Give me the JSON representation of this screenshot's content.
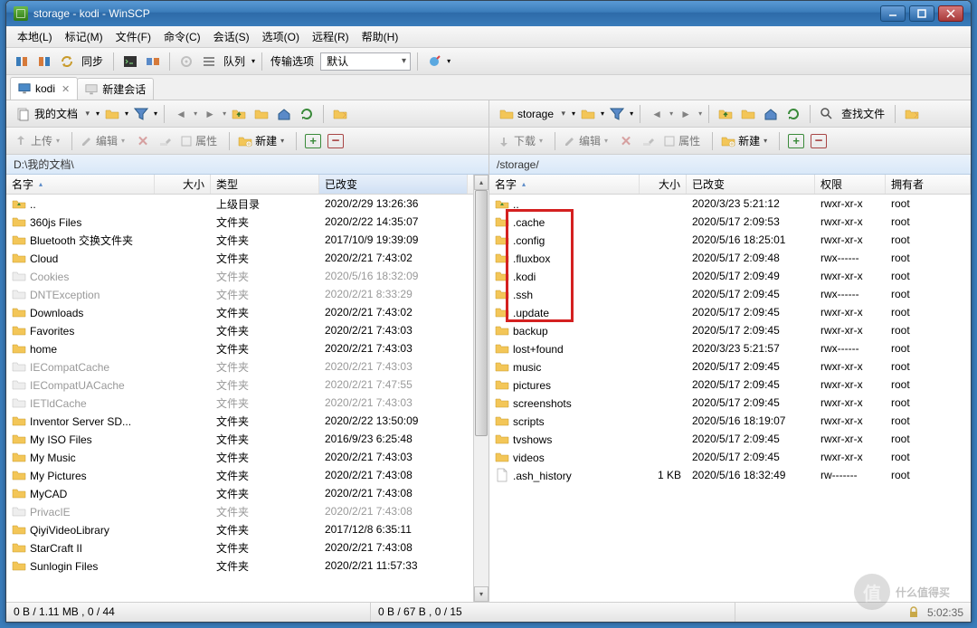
{
  "title": "storage - kodi - WinSCP",
  "menus": [
    "本地(L)",
    "标记(M)",
    "文件(F)",
    "命令(C)",
    "会话(S)",
    "选项(O)",
    "远程(R)",
    "帮助(H)"
  ],
  "toolbar": {
    "sync": "同步",
    "queue": "队列",
    "transfer_label": "传输选项",
    "transfer_value": "默认"
  },
  "tabs": {
    "kodi": "kodi",
    "new": "新建会话"
  },
  "navL": {
    "dir": "我的文档"
  },
  "navR": {
    "dir": "storage",
    "find": "查找文件"
  },
  "actions": {
    "upload": "上传",
    "download": "下载",
    "edit": "编辑",
    "props": "属性",
    "new": "新建"
  },
  "pathL": "D:\\我的文档\\",
  "pathR": "/storage/",
  "hdrL": {
    "name": "名字",
    "size": "大小",
    "type": "类型",
    "changed": "已改变"
  },
  "hdrR": {
    "name": "名字",
    "size": "大小",
    "changed": "已改变",
    "rights": "权限",
    "owner": "拥有者"
  },
  "leftRows": [
    {
      "n": "..",
      "t": "上级目录",
      "c": "2020/2/29  13:26:36",
      "up": true
    },
    {
      "n": "360js Files",
      "t": "文件夹",
      "c": "2020/2/22  14:35:07"
    },
    {
      "n": "Bluetooth 交换文件夹",
      "t": "文件夹",
      "c": "2017/10/9  19:39:09"
    },
    {
      "n": "Cloud",
      "t": "文件夹",
      "c": "2020/2/21  7:43:02"
    },
    {
      "n": "Cookies",
      "t": "文件夹",
      "c": "2020/5/16  18:32:09",
      "dim": true
    },
    {
      "n": "DNTException",
      "t": "文件夹",
      "c": "2020/2/21  8:33:29",
      "dim": true
    },
    {
      "n": "Downloads",
      "t": "文件夹",
      "c": "2020/2/21  7:43:02"
    },
    {
      "n": "Favorites",
      "t": "文件夹",
      "c": "2020/2/21  7:43:03"
    },
    {
      "n": "home",
      "t": "文件夹",
      "c": "2020/2/21  7:43:03"
    },
    {
      "n": "IECompatCache",
      "t": "文件夹",
      "c": "2020/2/21  7:43:03",
      "dim": true
    },
    {
      "n": "IECompatUACache",
      "t": "文件夹",
      "c": "2020/2/21  7:47:55",
      "dim": true
    },
    {
      "n": "IETldCache",
      "t": "文件夹",
      "c": "2020/2/21  7:43:03",
      "dim": true
    },
    {
      "n": "Inventor Server SD...",
      "t": "文件夹",
      "c": "2020/2/22  13:50:09"
    },
    {
      "n": "My ISO Files",
      "t": "文件夹",
      "c": "2016/9/23  6:25:48"
    },
    {
      "n": "My Music",
      "t": "文件夹",
      "c": "2020/2/21  7:43:03"
    },
    {
      "n": "My Pictures",
      "t": "文件夹",
      "c": "2020/2/21  7:43:08"
    },
    {
      "n": "MyCAD",
      "t": "文件夹",
      "c": "2020/2/21  7:43:08"
    },
    {
      "n": "PrivacIE",
      "t": "文件夹",
      "c": "2020/2/21  7:43:08",
      "dim": true
    },
    {
      "n": "QiyiVideoLibrary",
      "t": "文件夹",
      "c": "2017/12/8  6:35:11"
    },
    {
      "n": "StarCraft II",
      "t": "文件夹",
      "c": "2020/2/21  7:43:08"
    },
    {
      "n": "Sunlogin Files",
      "t": "文件夹",
      "c": "2020/2/21  11:57:33"
    }
  ],
  "rightRows": [
    {
      "n": "..",
      "c": "2020/3/23  5:21:12",
      "r": "rwxr-xr-x",
      "o": "root",
      "up": true
    },
    {
      "n": ".cache",
      "c": "2020/5/17  2:09:53",
      "r": "rwxr-xr-x",
      "o": "root"
    },
    {
      "n": ".config",
      "c": "2020/5/16  18:25:01",
      "r": "rwxr-xr-x",
      "o": "root"
    },
    {
      "n": ".fluxbox",
      "c": "2020/5/17  2:09:48",
      "r": "rwx------",
      "o": "root"
    },
    {
      "n": ".kodi",
      "c": "2020/5/17  2:09:49",
      "r": "rwxr-xr-x",
      "o": "root"
    },
    {
      "n": ".ssh",
      "c": "2020/5/17  2:09:45",
      "r": "rwx------",
      "o": "root"
    },
    {
      "n": ".update",
      "c": "2020/5/17  2:09:45",
      "r": "rwxr-xr-x",
      "o": "root"
    },
    {
      "n": "backup",
      "c": "2020/5/17  2:09:45",
      "r": "rwxr-xr-x",
      "o": "root"
    },
    {
      "n": "lost+found",
      "c": "2020/3/23  5:21:57",
      "r": "rwx------",
      "o": "root"
    },
    {
      "n": "music",
      "c": "2020/5/17  2:09:45",
      "r": "rwxr-xr-x",
      "o": "root"
    },
    {
      "n": "pictures",
      "c": "2020/5/17  2:09:45",
      "r": "rwxr-xr-x",
      "o": "root"
    },
    {
      "n": "screenshots",
      "c": "2020/5/17  2:09:45",
      "r": "rwxr-xr-x",
      "o": "root"
    },
    {
      "n": "scripts",
      "c": "2020/5/16  18:19:07",
      "r": "rwxr-xr-x",
      "o": "root"
    },
    {
      "n": "tvshows",
      "c": "2020/5/17  2:09:45",
      "r": "rwxr-xr-x",
      "o": "root"
    },
    {
      "n": "videos",
      "c": "2020/5/17  2:09:45",
      "r": "rwxr-xr-x",
      "o": "root"
    },
    {
      "n": ".ash_history",
      "s": "1 KB",
      "c": "2020/5/16  18:32:49",
      "r": "rw-------",
      "o": "root",
      "file": true
    }
  ],
  "statusL": "0 B / 1.11 MB ,   0 / 44",
  "statusR": "0 B / 67 B ,   0 / 15",
  "statusTime": "5:02:35",
  "watermark": "什么值得买"
}
